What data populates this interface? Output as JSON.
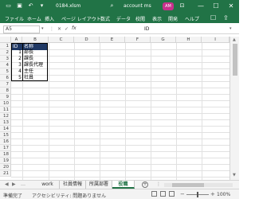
{
  "titlebar": {
    "filename": "0184.xlsm",
    "account": "account ms",
    "avatar": "AM",
    "minimize": "—",
    "maximize": "☐",
    "close": "✕"
  },
  "ribbon": {
    "tabs": [
      "ファイル",
      "ホーム",
      "挿入",
      "ページ レイアウト",
      "数式",
      "データ",
      "校閲",
      "表示",
      "開発",
      "ヘルプ"
    ]
  },
  "formula_bar": {
    "name_box": "A5",
    "fx": "fx",
    "content": "ID"
  },
  "columns": [
    "A",
    "B",
    "C",
    "D",
    "E",
    "F",
    "G",
    "H",
    "I"
  ],
  "rows": [
    "1",
    "2",
    "3",
    "4",
    "5",
    "6",
    "7",
    "8",
    "9",
    "10",
    "11",
    "12",
    "13",
    "14",
    "15",
    "16",
    "17",
    "18",
    "19",
    "20",
    "21"
  ],
  "table": {
    "header": {
      "id": "ID",
      "name": "名称"
    },
    "rows": [
      {
        "id": "1",
        "name": "部長"
      },
      {
        "id": "2",
        "name": "課長"
      },
      {
        "id": "3",
        "name": "課長代理"
      },
      {
        "id": "4",
        "name": "主任"
      },
      {
        "id": "5",
        "name": "社員"
      }
    ]
  },
  "sheet_tabs": [
    "work",
    "社員情報",
    "所属部署",
    "役職"
  ],
  "active_sheet": "役職",
  "status_bar": {
    "ready": "準備完了",
    "accessibility": "アクセシビリティ: 問題ありません",
    "zoom": "100%"
  },
  "colors": {
    "excel_green": "#217346",
    "header_fill": "#1f3864"
  }
}
